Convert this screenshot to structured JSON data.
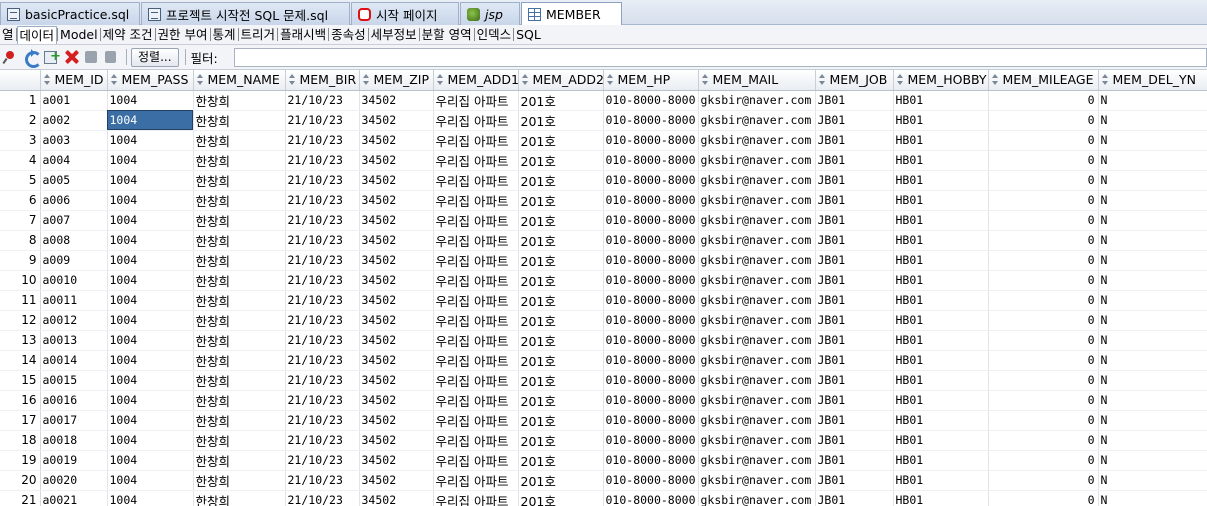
{
  "tabs": [
    {
      "label": "basicPractice.sql",
      "icon": "sql-file-icon"
    },
    {
      "label": "프로젝트 시작전 SQL 문제.sql",
      "icon": "sql-file-icon"
    },
    {
      "label": "시작 페이지",
      "icon": "oracle-icon"
    },
    {
      "label": "jsp",
      "icon": "connection-icon"
    },
    {
      "label": "MEMBER",
      "icon": "table-icon"
    }
  ],
  "subtabs": [
    "열",
    "데이터",
    "Model",
    "제약 조건",
    "권한 부여",
    "통계",
    "트리거",
    "플래시백",
    "종속성",
    "세부정보",
    "분할 영역",
    "인덱스",
    "SQL"
  ],
  "toolbar": {
    "sort_label": "정렬...",
    "filter_label": "필터:",
    "filter_value": ""
  },
  "columns": [
    "MEM_ID",
    "MEM_PASS",
    "MEM_NAME",
    "MEM_BIR",
    "MEM_ZIP",
    "MEM_ADD1",
    "MEM_ADD2",
    "MEM_HP",
    "MEM_MAIL",
    "MEM_JOB",
    "MEM_HOBBY",
    "MEM_MILEAGE",
    "MEM_DEL_YN"
  ],
  "rows": [
    [
      "1",
      "a001",
      "1004",
      "한창희",
      "21/10/23",
      "34502",
      "우리집 아파트",
      "201호",
      "010-8000-8000",
      "gksbir@naver.com",
      "JB01",
      "HB01",
      "0",
      "N"
    ],
    [
      "2",
      "a002",
      "1004",
      "한창희",
      "21/10/23",
      "34502",
      "우리집 아파트",
      "201호",
      "010-8000-8000",
      "gksbir@naver.com",
      "JB01",
      "HB01",
      "0",
      "N"
    ],
    [
      "3",
      "a003",
      "1004",
      "한창희",
      "21/10/23",
      "34502",
      "우리집 아파트",
      "201호",
      "010-8000-8000",
      "gksbir@naver.com",
      "JB01",
      "HB01",
      "0",
      "N"
    ],
    [
      "4",
      "a004",
      "1004",
      "한창희",
      "21/10/23",
      "34502",
      "우리집 아파트",
      "201호",
      "010-8000-8000",
      "gksbir@naver.com",
      "JB01",
      "HB01",
      "0",
      "N"
    ],
    [
      "5",
      "a005",
      "1004",
      "한창희",
      "21/10/23",
      "34502",
      "우리집 아파트",
      "201호",
      "010-8000-8000",
      "gksbir@naver.com",
      "JB01",
      "HB01",
      "0",
      "N"
    ],
    [
      "6",
      "a006",
      "1004",
      "한창희",
      "21/10/23",
      "34502",
      "우리집 아파트",
      "201호",
      "010-8000-8000",
      "gksbir@naver.com",
      "JB01",
      "HB01",
      "0",
      "N"
    ],
    [
      "7",
      "a007",
      "1004",
      "한창희",
      "21/10/23",
      "34502",
      "우리집 아파트",
      "201호",
      "010-8000-8000",
      "gksbir@naver.com",
      "JB01",
      "HB01",
      "0",
      "N"
    ],
    [
      "8",
      "a008",
      "1004",
      "한창희",
      "21/10/23",
      "34502",
      "우리집 아파트",
      "201호",
      "010-8000-8000",
      "gksbir@naver.com",
      "JB01",
      "HB01",
      "0",
      "N"
    ],
    [
      "9",
      "a009",
      "1004",
      "한창희",
      "21/10/23",
      "34502",
      "우리집 아파트",
      "201호",
      "010-8000-8000",
      "gksbir@naver.com",
      "JB01",
      "HB01",
      "0",
      "N"
    ],
    [
      "10",
      "a0010",
      "1004",
      "한창희",
      "21/10/23",
      "34502",
      "우리집 아파트",
      "201호",
      "010-8000-8000",
      "gksbir@naver.com",
      "JB01",
      "HB01",
      "0",
      "N"
    ],
    [
      "11",
      "a0011",
      "1004",
      "한창희",
      "21/10/23",
      "34502",
      "우리집 아파트",
      "201호",
      "010-8000-8000",
      "gksbir@naver.com",
      "JB01",
      "HB01",
      "0",
      "N"
    ],
    [
      "12",
      "a0012",
      "1004",
      "한창희",
      "21/10/23",
      "34502",
      "우리집 아파트",
      "201호",
      "010-8000-8000",
      "gksbir@naver.com",
      "JB01",
      "HB01",
      "0",
      "N"
    ],
    [
      "13",
      "a0013",
      "1004",
      "한창희",
      "21/10/23",
      "34502",
      "우리집 아파트",
      "201호",
      "010-8000-8000",
      "gksbir@naver.com",
      "JB01",
      "HB01",
      "0",
      "N"
    ],
    [
      "14",
      "a0014",
      "1004",
      "한창희",
      "21/10/23",
      "34502",
      "우리집 아파트",
      "201호",
      "010-8000-8000",
      "gksbir@naver.com",
      "JB01",
      "HB01",
      "0",
      "N"
    ],
    [
      "15",
      "a0015",
      "1004",
      "한창희",
      "21/10/23",
      "34502",
      "우리집 아파트",
      "201호",
      "010-8000-8000",
      "gksbir@naver.com",
      "JB01",
      "HB01",
      "0",
      "N"
    ],
    [
      "16",
      "a0016",
      "1004",
      "한창희",
      "21/10/23",
      "34502",
      "우리집 아파트",
      "201호",
      "010-8000-8000",
      "gksbir@naver.com",
      "JB01",
      "HB01",
      "0",
      "N"
    ],
    [
      "17",
      "a0017",
      "1004",
      "한창희",
      "21/10/23",
      "34502",
      "우리집 아파트",
      "201호",
      "010-8000-8000",
      "gksbir@naver.com",
      "JB01",
      "HB01",
      "0",
      "N"
    ],
    [
      "18",
      "a0018",
      "1004",
      "한창희",
      "21/10/23",
      "34502",
      "우리집 아파트",
      "201호",
      "010-8000-8000",
      "gksbir@naver.com",
      "JB01",
      "HB01",
      "0",
      "N"
    ],
    [
      "19",
      "a0019",
      "1004",
      "한창희",
      "21/10/23",
      "34502",
      "우리집 아파트",
      "201호",
      "010-8000-8000",
      "gksbir@naver.com",
      "JB01",
      "HB01",
      "0",
      "N"
    ],
    [
      "20",
      "a0020",
      "1004",
      "한창희",
      "21/10/23",
      "34502",
      "우리집 아파트",
      "201호",
      "010-8000-8000",
      "gksbir@naver.com",
      "JB01",
      "HB01",
      "0",
      "N"
    ],
    [
      "21",
      "a0021",
      "1004",
      "한창희",
      "21/10/23",
      "34502",
      "우리집 아파트",
      "201호",
      "010-8000-8000",
      "gksbir@naver.com",
      "JB01",
      "HB01",
      "0",
      "N"
    ]
  ],
  "selected_cell": {
    "row": 2,
    "column": "MEM_PASS"
  },
  "colors": {
    "selection": "#3b6ea5",
    "tab_strip": "#d6dfec"
  }
}
